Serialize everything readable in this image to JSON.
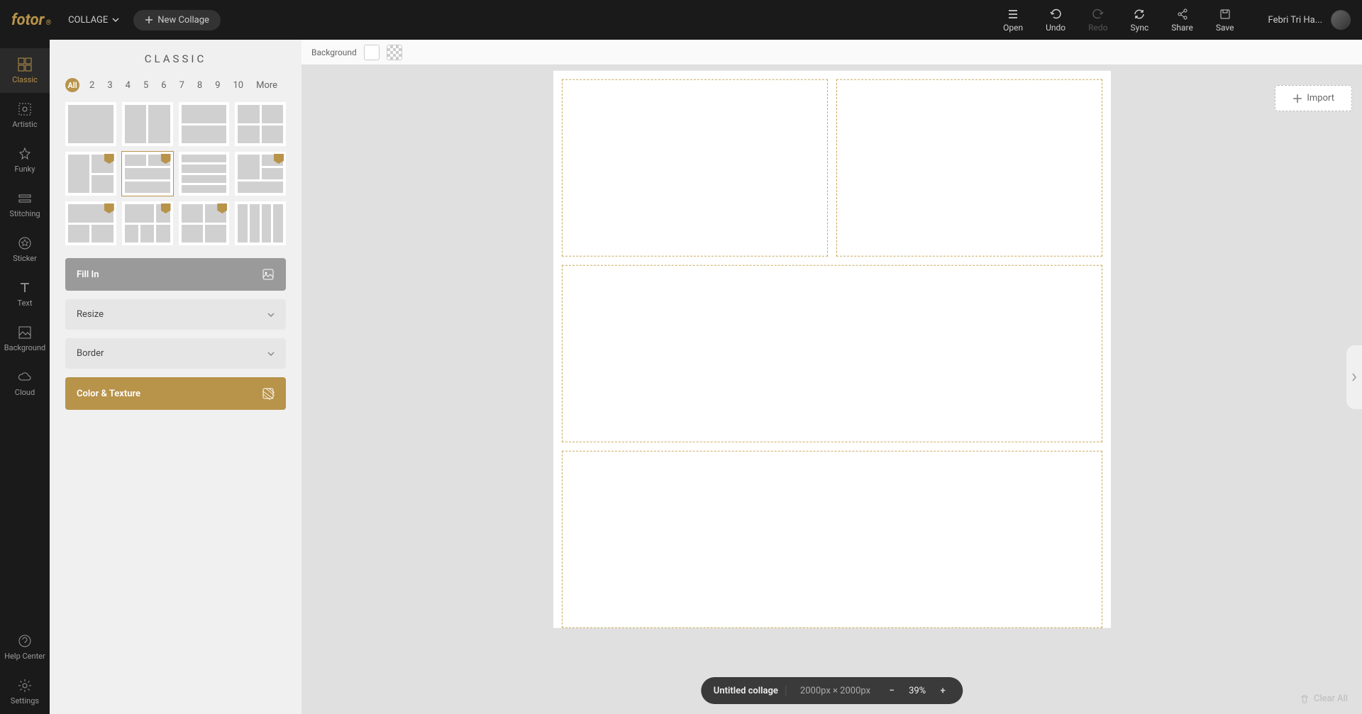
{
  "brand": "fotor",
  "header": {
    "mode": "COLLAGE",
    "new_collage": "New Collage",
    "actions": {
      "open": "Open",
      "undo": "Undo",
      "redo": "Redo",
      "sync": "Sync",
      "share": "Share",
      "save": "Save"
    },
    "user_name": "Febri Tri Ha..."
  },
  "rail": {
    "classic": "Classic",
    "artistic": "Artistic",
    "funky": "Funky",
    "stitching": "Stitching",
    "sticker": "Sticker",
    "text": "Text",
    "background": "Background",
    "cloud": "Cloud",
    "help": "Help Center",
    "settings": "Settings"
  },
  "panel": {
    "title": "CLASSIC",
    "filters": [
      "All",
      "2",
      "3",
      "4",
      "5",
      "6",
      "7",
      "8",
      "9",
      "10",
      "More"
    ],
    "buttons": {
      "fillin": "Fill In",
      "resize": "Resize",
      "border": "Border",
      "texture": "Color & Texture"
    }
  },
  "canvas_toolbar": {
    "background_label": "Background"
  },
  "right": {
    "import": "Import",
    "clear_all": "Clear All"
  },
  "status": {
    "title": "Untitled collage",
    "dimensions": "2000px × 2000px",
    "zoom": "39%"
  }
}
